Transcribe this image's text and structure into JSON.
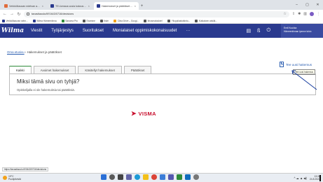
{
  "browser": {
    "tabs": [
      {
        "label": "Verkkölkauvan edetvan akoluu · ",
        "active": false,
        "favicon_color": "#e06b3a"
      },
      {
        "label": "TEI-lomaus uusia kokouspä.PP · ",
        "active": false,
        "favicon_color": "#2a3a8e"
      },
      {
        "label": "Hakemukset ja päätökset - Wilm",
        "active": true,
        "favicon_color": "#2a3a8e"
      }
    ],
    "tab_close": "×",
    "new_tab": "+",
    "window_controls": {
      "minimize": "–",
      "maximize": "▢",
      "close": "✕"
    },
    "url": "tavastiaoulu/fi/!0443/0716/decisions",
    "bookmarks": [
      {
        "label": "Verkkölkauvan sebn...",
        "color": "#2a3a8e"
      },
      {
        "label": "Wilma Hämeenlinna",
        "color": "#2a3a8e"
      },
      {
        "label": "Sanoma Pro",
        "color": "#2e8b3a"
      },
      {
        "label": "Examine",
        "color": "#555555"
      },
      {
        "label": "Itslrn",
        "color": "#555555"
      },
      {
        "label": "Clina Drive – Googl...",
        "color": "#f3a21b"
      },
      {
        "label": "Itriosmatosken!",
        "color": "#555555"
      },
      {
        "label": "Ylioppilastutkinto...",
        "color": "#555555"
      },
      {
        "label": "Kotkatoen ankilä...",
        "color": "#555555"
      }
    ]
  },
  "wilma": {
    "logo": "Wilma",
    "menu": [
      "Viestit",
      "Työjärjestys",
      "Suoritukset",
      "Monialaiset oppimiskokonaisuudet",
      "···"
    ],
    "user": {
      "name": "Emil Kuukka",
      "subtitle": "Hämeenlinnan lyseon lukio"
    },
    "icons": {
      "page": "▤",
      "switch": "ß",
      "logout": "⏻"
    }
  },
  "breadcrumb": {
    "link": "Oma etusivu",
    "separator": " › ",
    "current": "Hakemukset ja päätökset"
  },
  "tabs": [
    "Kaikki",
    "Avoimet hakemukset",
    "Käsitellyt hakemukset",
    "Päätökset"
  ],
  "active_tab": "Kaikki",
  "new_application": "Tee uusi hakemus",
  "tooltip": "Tee uusi hakemus",
  "empty_state": {
    "title": "Miksi tämä sivu on tyhjä?",
    "description": "Opiskelijalla ei ole hakemuksia tai päätöksiä."
  },
  "footer_brand": "VISMA",
  "status_url": "https://tavastiaoulu.fi/!0443/0716/decisions",
  "taskbar": {
    "weather_temp": "19°C",
    "weather_desc": "Puolipilvistä",
    "time": "13.08",
    "date": "24.8.2022",
    "tray_icons": "^ ☁ ▲ ◀)"
  },
  "colors": {
    "wilma_header": "#2a3a8e",
    "active_tab_border": "#2e8b3a",
    "link": "#2a5db0",
    "visma_red": "#c8102e"
  }
}
